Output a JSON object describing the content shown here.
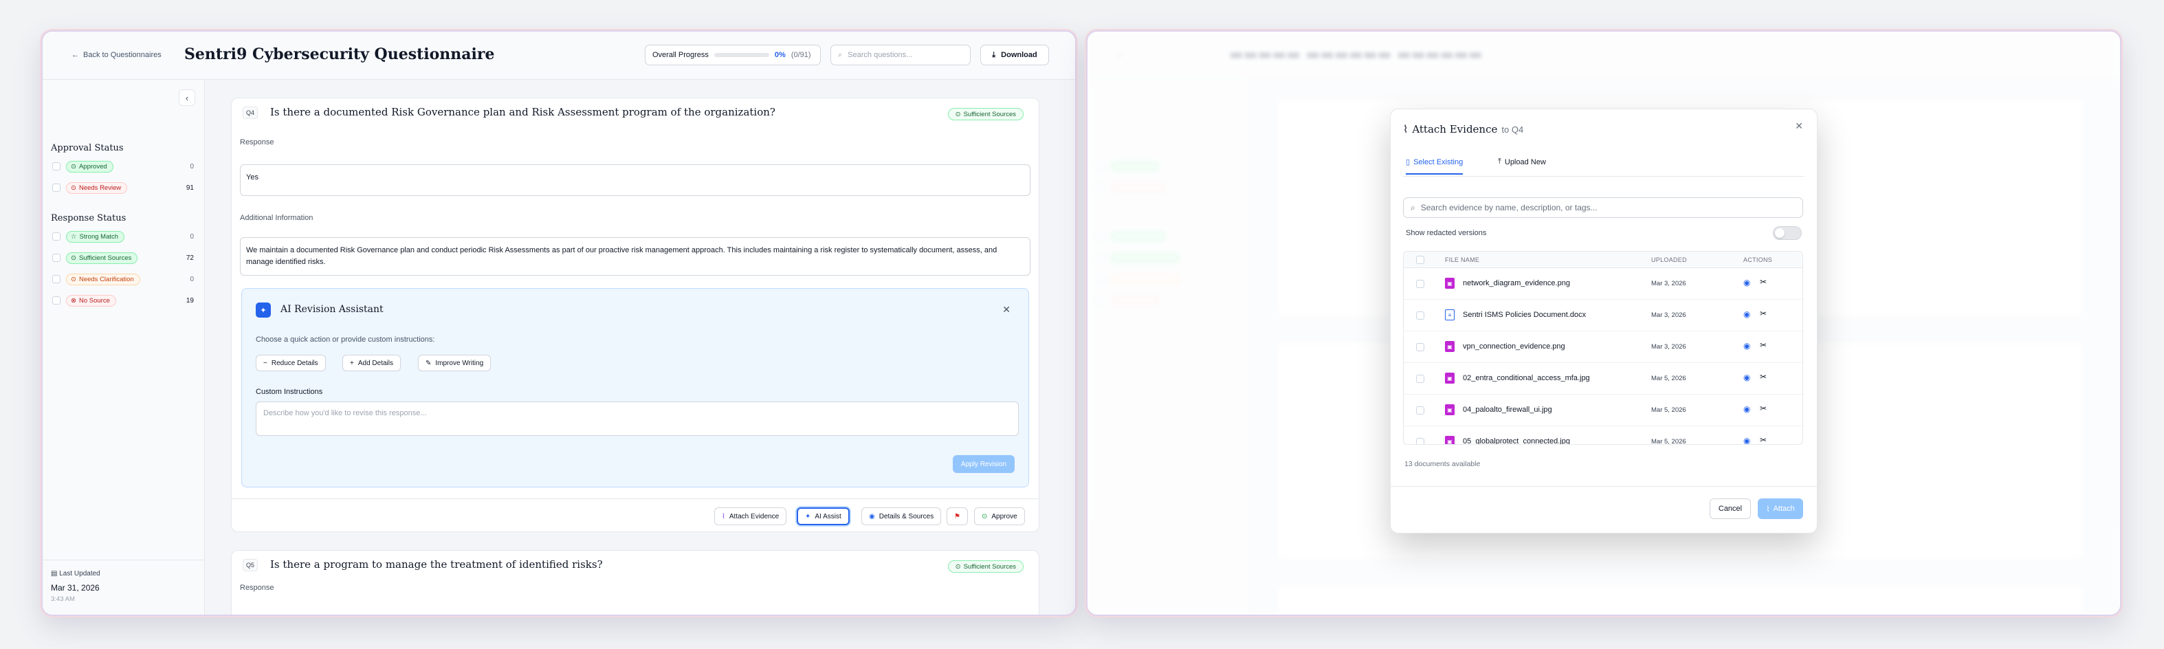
{
  "header": {
    "back_label": "Back to Questionnaires",
    "title": "Sentri9 Cybersecurity Questionnaire",
    "progress_label": "Overall Progress",
    "progress_pct": "0%",
    "progress_count": "(0/91)",
    "progress_value": 0,
    "search_placeholder": "Search questions...",
    "download_label": "Download"
  },
  "sidebar": {
    "approval_title": "Approval Status",
    "approval": [
      {
        "label": "Approved",
        "count": "0",
        "color": "green"
      },
      {
        "label": "Needs Review",
        "count": "91",
        "color": "red"
      }
    ],
    "response_title": "Response Status",
    "response": [
      {
        "label": "Strong Match",
        "count": "0",
        "color": "green"
      },
      {
        "label": "Sufficient Sources",
        "count": "72",
        "color": "green"
      },
      {
        "label": "Needs Clarification",
        "count": "0",
        "color": "orange"
      },
      {
        "label": "No Source",
        "count": "19",
        "color": "red"
      }
    ],
    "last_updated_label": "Last Updated",
    "last_updated_date": "Mar 31, 2026",
    "last_updated_time": "3:43 AM"
  },
  "questions": [
    {
      "num": "Q4",
      "text": "Is there a documented Risk Governance plan and Risk Assessment program of the organization?",
      "badge": "Sufficient Sources",
      "response_label": "Response",
      "response": "Yes",
      "info_label": "Additional Information",
      "info": "We maintain a documented Risk Governance plan and conduct periodic Risk Assessments as part of our proactive risk management approach. This includes maintaining a risk register to systematically document, assess, and manage identified risks."
    },
    {
      "num": "Q5",
      "text": "Is there a program to manage the treatment of identified risks?",
      "badge": "Sufficient Sources",
      "response_label": "Response"
    }
  ],
  "ai": {
    "title": "AI Revision Assistant",
    "hint": "Choose a quick action or provide custom instructions:",
    "actions": [
      "Reduce Details",
      "Add Details",
      "Improve Writing"
    ],
    "custom_label": "Custom Instructions",
    "custom_placeholder": "Describe how you'd like to revise this response...",
    "apply_label": "Apply Revision"
  },
  "card_actions": {
    "attach": "Attach Evidence",
    "ai_assist": "AI Assist",
    "details": "Details & Sources",
    "approve": "Approve"
  },
  "modal": {
    "title": "Attach Evidence",
    "subtitle": "to Q4",
    "tabs": [
      "Select Existing",
      "Upload New"
    ],
    "search_placeholder": "Search evidence by name, description, or tags...",
    "redacted_label": "Show redacted versions",
    "columns": [
      "FILE NAME",
      "UPLOADED",
      "ACTIONS"
    ],
    "files": [
      {
        "name": "network_diagram_evidence.png",
        "uploaded": "Mar 3, 2026",
        "type": "image"
      },
      {
        "name": "Sentri ISMS Policies Document.docx",
        "uploaded": "Mar 3, 2026",
        "type": "doc"
      },
      {
        "name": "vpn_connection_evidence.png",
        "uploaded": "Mar 3, 2026",
        "type": "image"
      },
      {
        "name": "02_entra_conditional_access_mfa.jpg",
        "uploaded": "Mar 5, 2026",
        "type": "image"
      },
      {
        "name": "04_paloalto_firewall_ui.jpg",
        "uploaded": "Mar 5, 2026",
        "type": "image"
      },
      {
        "name": "05_globalprotect_connected.jpg",
        "uploaded": "Mar 5, 2026",
        "type": "image"
      }
    ],
    "docs_count": "13 documents available",
    "cancel": "Cancel",
    "attach": "Attach"
  },
  "colors": {
    "accent": "#2563eb",
    "success": "#16a34a",
    "danger": "#dc2626",
    "warning": "#ea580c"
  }
}
